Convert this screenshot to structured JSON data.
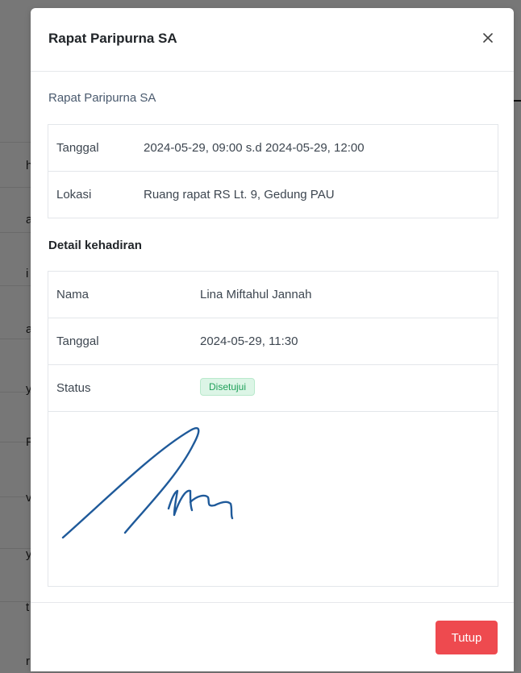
{
  "modal": {
    "title": "Rapat Paripurna SA",
    "close_icon": "close-icon",
    "subtitle": "Rapat Paripurna SA",
    "info": [
      {
        "label": "Tanggal",
        "value": "2024-05-29, 09:00 s.d 2024-05-29, 12:00"
      },
      {
        "label": "Lokasi",
        "value": "Ruang rapat RS Lt. 9, Gedung PAU"
      }
    ],
    "attendance_title": "Detail kehadiran",
    "attendance": {
      "name_label": "Nama",
      "name_value": "Lina Miftahul Jannah",
      "date_label": "Tanggal",
      "date_value": "2024-05-29, 11:30",
      "status_label": "Status",
      "status_value": "Disetujui"
    },
    "close_button": "Tutup"
  },
  "background": {
    "letters": [
      "h",
      "a",
      "i",
      "a",
      "y",
      "Fi",
      "v",
      "y",
      "t",
      "r"
    ]
  },
  "colors": {
    "danger": "#ee4a4f",
    "success_text": "#20a05a",
    "success_bg": "#dcf5e6",
    "signature_ink": "#1f5a9a"
  }
}
